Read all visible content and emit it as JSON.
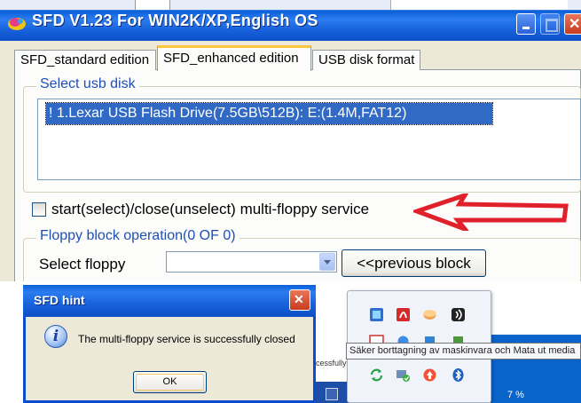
{
  "main_window": {
    "title": "SFD V1.23 For WIN2K/XP,English OS",
    "tabs": [
      {
        "label": "SFD_standard edition"
      },
      {
        "label": "SFD_enhanced edition"
      },
      {
        "label": "USB disk format"
      }
    ],
    "select_usb_group": {
      "label": "Select usb disk",
      "items": [
        "! 1.Lexar USB Flash Drive(7.5GB\\512B): E:(1.4M,FAT12)"
      ]
    },
    "multi_floppy_checkbox": {
      "label": "start(select)/close(unselect) multi-floppy service",
      "checked": false
    },
    "floppy_group": {
      "label": "Floppy block operation(0 OF 0)",
      "select_label": "Select floppy",
      "select_value": "",
      "prev_button": "<<previous block"
    },
    "annotation_arrow_color": "#e0202a"
  },
  "hint_dialog": {
    "title": "SFD hint",
    "message": "The multi-floppy service is successfully closed",
    "ok_button": "OK"
  },
  "background_text": "cessfully c",
  "tray_popup": {
    "tooltip": "Säker borttagning av maskinvara och Mata ut media",
    "icons": [
      "app-blue-icon",
      "acrobat-icon",
      "drive-icon",
      "audio-icon",
      "windows-icon",
      "ie-icon",
      "security-icon",
      "network-icon",
      "refresh-icon",
      "usb-eject-icon",
      "update-icon",
      "bluetooth-icon"
    ]
  },
  "taskbar": {
    "percent_text": "7 %"
  }
}
